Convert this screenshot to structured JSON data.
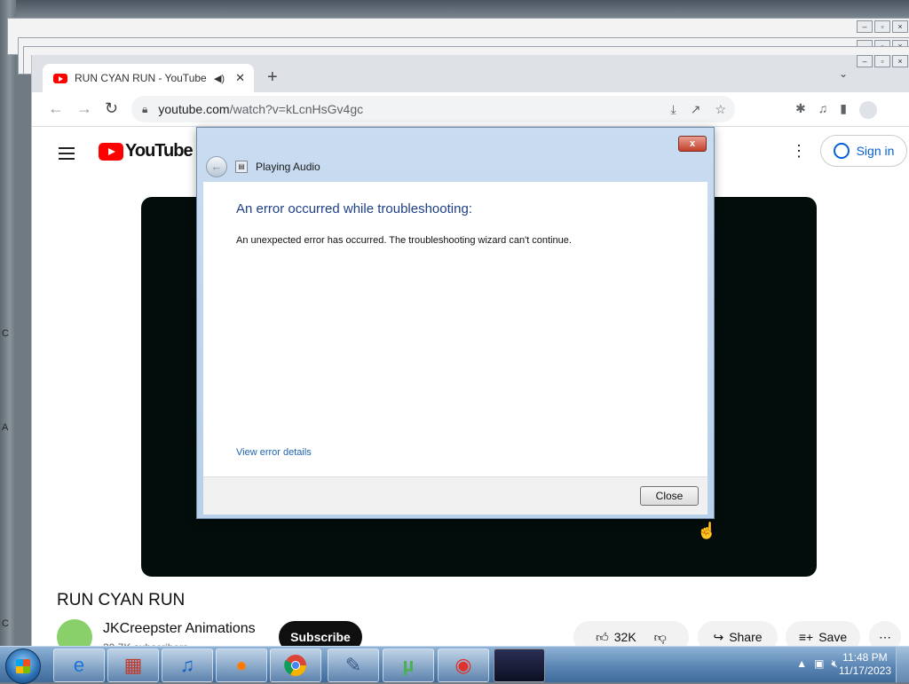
{
  "desktop": {
    "side_letters": [
      "C",
      "A",
      "C"
    ]
  },
  "browser": {
    "tab_title": "RUN CYAN RUN - YouTube",
    "new_tab": "+",
    "url_host": "youtube.com",
    "url_path": "/watch?v=kLcnHsGv4gc"
  },
  "youtube": {
    "logo_text": "YouTube",
    "sign_in": "Sign in",
    "video_title": "RUN CYAN RUN",
    "channel_name": "JKCreepster Animations",
    "subscribers": "30.7K subscribers",
    "subscribe": "Subscribe",
    "likes": "32K",
    "share": "Share",
    "save": "Save"
  },
  "dialog": {
    "window_title": "Playing Audio",
    "close_x": "x",
    "heading": "An error occurred while troubleshooting:",
    "message": "An unexpected error has occurred. The troubleshooting wizard can't continue.",
    "link": "View error details",
    "close_button": "Close"
  },
  "taskbar": {
    "time": "11:48 PM",
    "date": "11/17/2023",
    "apps": [
      "internet-explorer",
      "store-app",
      "itunes",
      "firefox",
      "chrome",
      "notepad",
      "utorrent",
      "security-app",
      "media-app"
    ]
  }
}
